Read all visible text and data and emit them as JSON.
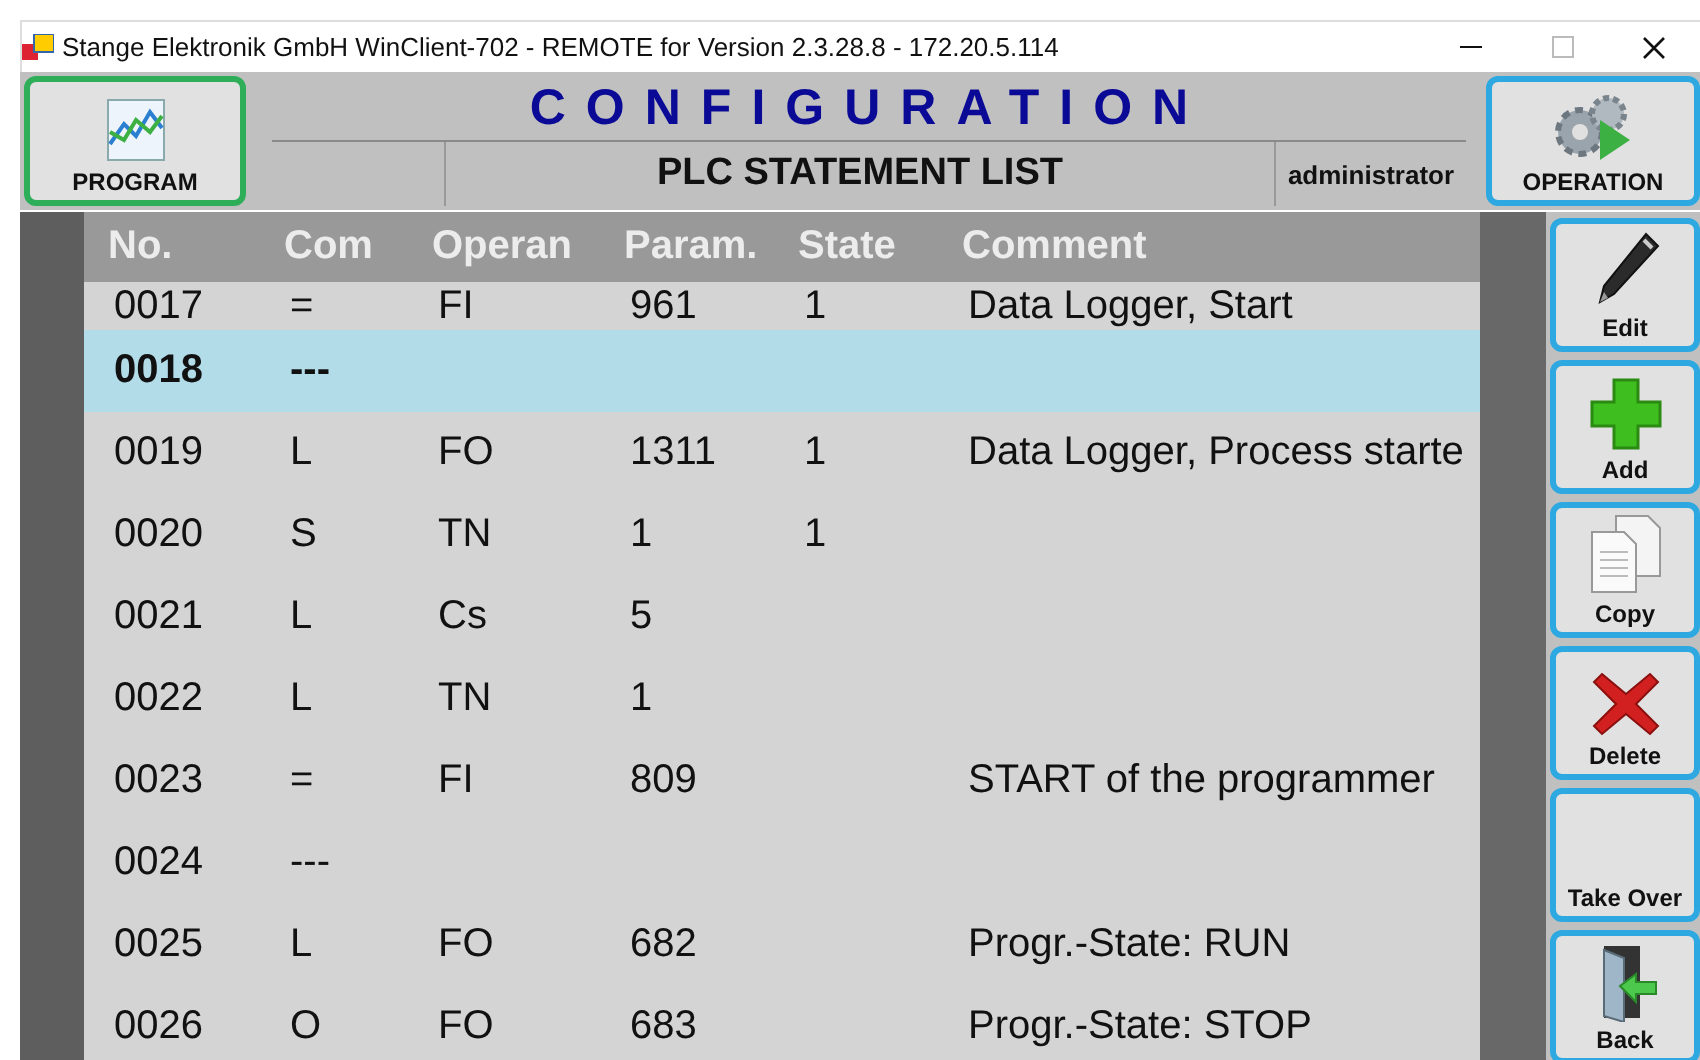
{
  "window": {
    "title": "Stange Elektronik GmbH WinClient-702 - REMOTE for Version 2.3.28.8 - 172.20.5.114"
  },
  "header": {
    "title": "CONFIGURATION",
    "subtitle": "PLC STATEMENT LIST",
    "user": "administrator",
    "left_button": {
      "label": "PROGRAM",
      "kind": "chart"
    },
    "right_button": {
      "label": "OPERATION",
      "kind": "gears"
    }
  },
  "table": {
    "columns": [
      "No.",
      "Com",
      "Operan",
      "Param.",
      "State",
      "Comment"
    ],
    "rows": [
      {
        "cells": [
          "0017",
          "=",
          "FI",
          "961",
          "1",
          "Data Logger, Start"
        ],
        "selected": false
      },
      {
        "cells": [
          "0018",
          "---",
          "",
          "",
          "",
          ""
        ],
        "selected": true
      },
      {
        "cells": [
          "0019",
          "L",
          "FO",
          "1311",
          "1",
          "Data Logger, Process starte"
        ],
        "selected": false
      },
      {
        "cells": [
          "0020",
          "S",
          "TN",
          "1",
          "1",
          ""
        ],
        "selected": false
      },
      {
        "cells": [
          "0021",
          "L",
          "Cs",
          "5",
          "",
          ""
        ],
        "selected": false
      },
      {
        "cells": [
          "0022",
          "L",
          "TN",
          "1",
          "",
          ""
        ],
        "selected": false
      },
      {
        "cells": [
          "0023",
          "=",
          "FI",
          "809",
          "",
          "START of the programmer"
        ],
        "selected": false
      },
      {
        "cells": [
          "0024",
          "---",
          "",
          "",
          "",
          ""
        ],
        "selected": false
      },
      {
        "cells": [
          "0025",
          "L",
          "FO",
          "682",
          "",
          "Progr.-State: RUN"
        ],
        "selected": false
      },
      {
        "cells": [
          "0026",
          "O",
          "FO",
          "683",
          "",
          "Progr.-State: STOP"
        ],
        "selected": false
      }
    ]
  },
  "side_buttons": [
    {
      "label": "Edit",
      "kind": "pen"
    },
    {
      "label": "Add",
      "kind": "plus"
    },
    {
      "label": "Copy",
      "kind": "copy"
    },
    {
      "label": "Delete",
      "kind": "cross"
    },
    {
      "label": "Take Over",
      "kind": "none"
    },
    {
      "label": "Back",
      "kind": "door"
    }
  ]
}
